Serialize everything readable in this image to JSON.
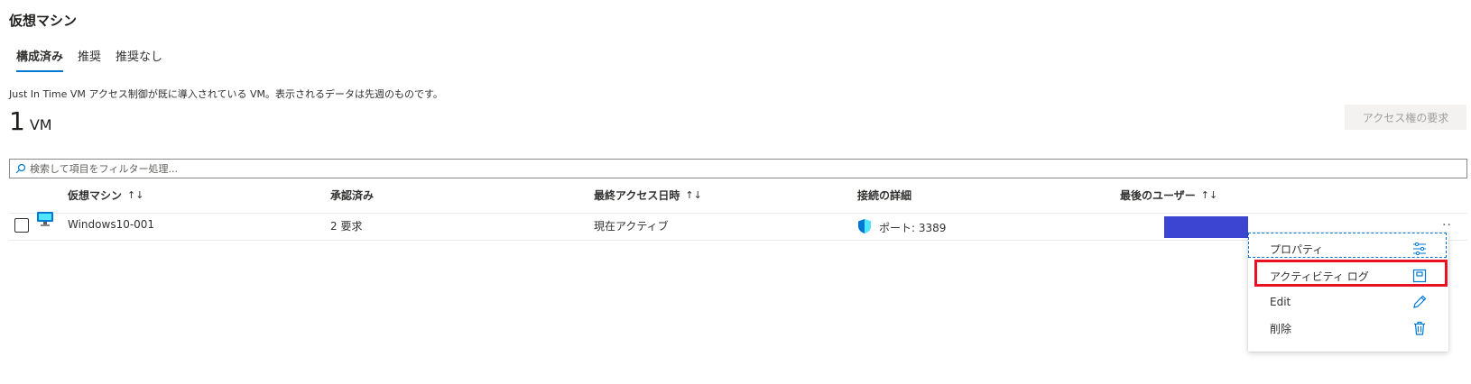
{
  "page": {
    "title": "仮想マシン",
    "tabs": [
      {
        "label": "構成済み",
        "active": true
      },
      {
        "label": "推奨",
        "active": false
      },
      {
        "label": "推奨なし",
        "active": false
      }
    ],
    "description": "Just In Time VM アクセス制御が既に導入されている VM。表示されるデータは先週のものです。",
    "count": {
      "number": "1",
      "unit": "VM"
    },
    "request_button": "アクセス権の要求"
  },
  "search": {
    "placeholder": "検索して項目をフィルター処理..."
  },
  "table": {
    "columns": [
      {
        "label": "仮想マシン",
        "sort": "↑↓"
      },
      {
        "label": "承認済み",
        "sort": ""
      },
      {
        "label": "最終アクセス日時",
        "sort": "↑↓"
      },
      {
        "label": "接続の詳細",
        "sort": ""
      },
      {
        "label": "最後のユーザー",
        "sort": "↑↓"
      }
    ],
    "rows": [
      {
        "vm": "Windows10-001",
        "approved": "2 要求",
        "last_access": "現在アクティブ",
        "connection": "ポート: 3389",
        "last_user": "",
        "more": "··"
      }
    ]
  },
  "context_menu": {
    "items": [
      {
        "label": "プロパティ",
        "icon": "properties-icon"
      },
      {
        "label": "アクティビティ ログ",
        "icon": "activity-log-icon"
      },
      {
        "label": "Edit",
        "icon": "pencil-icon"
      },
      {
        "label": "削除",
        "icon": "trash-icon"
      }
    ]
  },
  "colors": {
    "accent": "#0078d4",
    "highlight": "#e81123",
    "redacted": "#3b45d1"
  }
}
